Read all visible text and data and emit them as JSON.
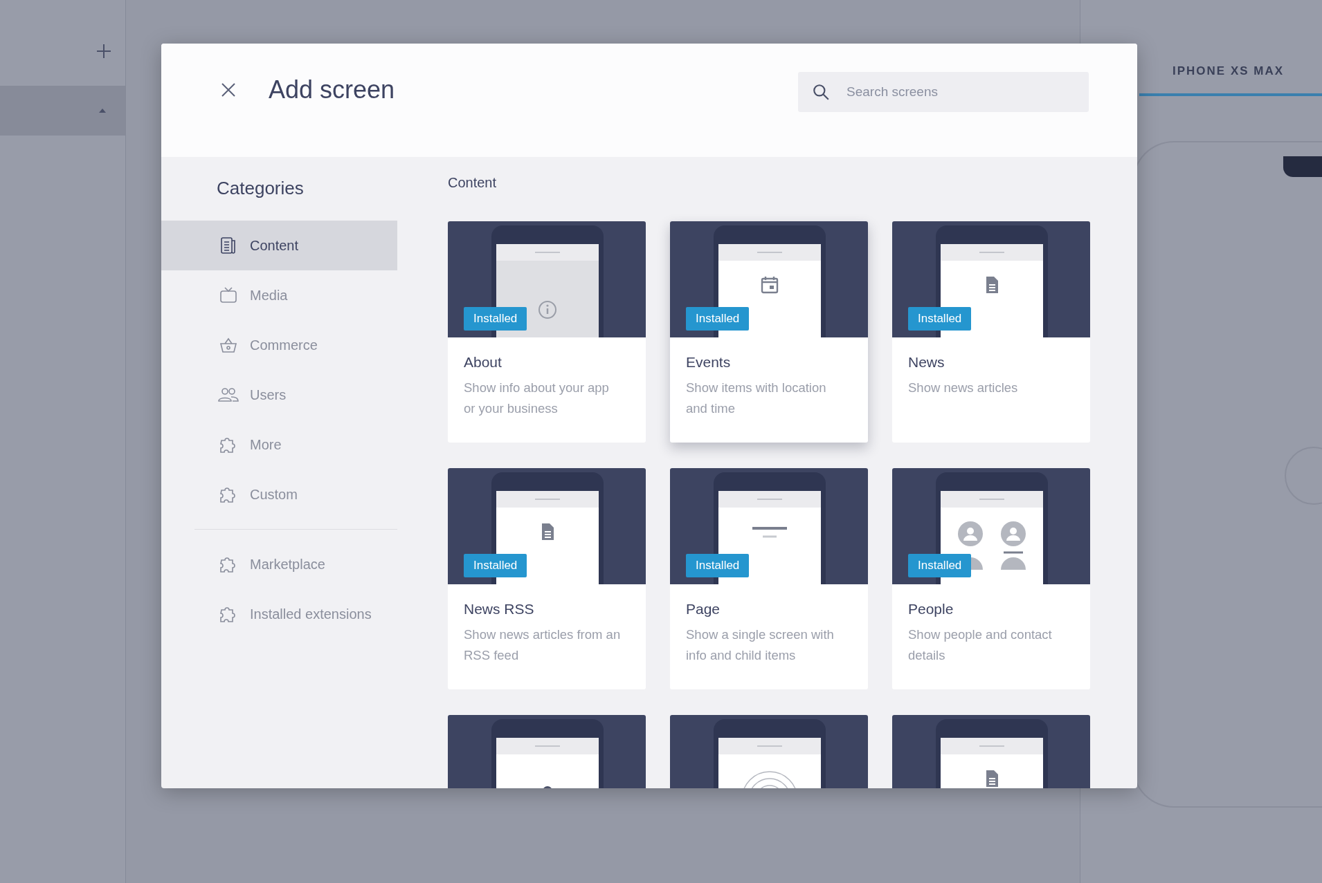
{
  "background": {
    "device_tab": "IPHONE XS MAX"
  },
  "dialog": {
    "title": "Add screen",
    "search": {
      "placeholder": "Search screens"
    }
  },
  "sidebar": {
    "heading": "Categories",
    "items": [
      {
        "label": "Content",
        "kind": "content",
        "selected": true
      },
      {
        "label": "Media",
        "kind": "media",
        "selected": false
      },
      {
        "label": "Commerce",
        "kind": "commerce",
        "selected": false
      },
      {
        "label": "Users",
        "kind": "users",
        "selected": false
      },
      {
        "label": "More",
        "kind": "extension",
        "selected": false
      },
      {
        "label": "Custom",
        "kind": "extension",
        "selected": false
      }
    ],
    "extra_items": [
      {
        "label": "Marketplace",
        "kind": "extension",
        "selected": false
      },
      {
        "label": "Installed extensions",
        "kind": "extension",
        "selected": false
      }
    ]
  },
  "section": {
    "heading": "Content",
    "cards": [
      {
        "kind": "info",
        "badge": "Installed",
        "title": "About",
        "description": "Show info about your app or your business",
        "hovered": false
      },
      {
        "kind": "calendar",
        "badge": "Installed",
        "title": "Events",
        "description": "Show items with location and time",
        "hovered": true
      },
      {
        "kind": "document",
        "badge": "Installed",
        "title": "News",
        "description": "Show news articles",
        "hovered": false
      },
      {
        "kind": "document",
        "badge": "Installed",
        "title": "News RSS",
        "description": "Show news articles from an RSS feed",
        "hovered": false
      },
      {
        "kind": "lines",
        "badge": "Installed",
        "title": "Page",
        "description": "Show a single screen with info and child items",
        "hovered": false
      },
      {
        "kind": "people",
        "badge": "Installed",
        "title": "People",
        "description": "Show people and contact details",
        "hovered": false
      },
      {
        "kind": "pin",
        "hovered": false
      },
      {
        "kind": "rings",
        "hovered": false
      },
      {
        "kind": "document",
        "hovered": false
      }
    ]
  }
}
